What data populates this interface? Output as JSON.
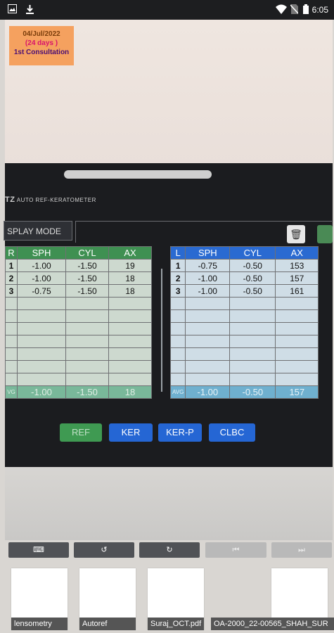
{
  "status_bar": {
    "time": "6:05"
  },
  "consultation": {
    "date": "04/Jul/2022",
    "days": "(24 days )",
    "label": "1st Consultation"
  },
  "device": {
    "brand_prefix": "TZ",
    "brand_text": "AUTO REF-KERATOMETER",
    "display_mode": "SPLAY MODE",
    "right_eye": {
      "label": "R",
      "headers": [
        "SPH",
        "CYL",
        "AX"
      ],
      "rows": [
        {
          "n": "1",
          "sph": "-1.00",
          "cyl": "-1.50",
          "ax": "19"
        },
        {
          "n": "2",
          "sph": "-1.00",
          "cyl": "-1.50",
          "ax": "18"
        },
        {
          "n": "3",
          "sph": "-0.75",
          "cyl": "-1.50",
          "ax": "18"
        }
      ],
      "avg_label": "VG",
      "avg": {
        "sph": "-1.00",
        "cyl": "-1.50",
        "ax": "18"
      }
    },
    "left_eye": {
      "label": "L",
      "headers": [
        "SPH",
        "CYL",
        "AX"
      ],
      "rows": [
        {
          "n": "1",
          "sph": "-0.75",
          "cyl": "-0.50",
          "ax": "153"
        },
        {
          "n": "2",
          "sph": "-1.00",
          "cyl": "-0.50",
          "ax": "157"
        },
        {
          "n": "3",
          "sph": "-1.00",
          "cyl": "-0.50",
          "ax": "161"
        }
      ],
      "avg_label": "AVG",
      "avg": {
        "sph": "-1.00",
        "cyl": "-0.50",
        "ax": "157"
      }
    },
    "buttons": {
      "ref": "REF",
      "ker": "KER",
      "kerp": "KER-P",
      "clbc": "CLBC"
    }
  },
  "toolbar": {
    "keyboard": "⌨",
    "rotate_left": "↺",
    "rotate_right": "↻",
    "first": "⏮",
    "last": "⏭"
  },
  "thumbnails": [
    {
      "label": "lensometry"
    },
    {
      "label": "Autoref"
    },
    {
      "label": "Suraj_OCT.pdf"
    },
    {
      "label": "OA-2000_22-00565_SHAH_SUR"
    }
  ]
}
